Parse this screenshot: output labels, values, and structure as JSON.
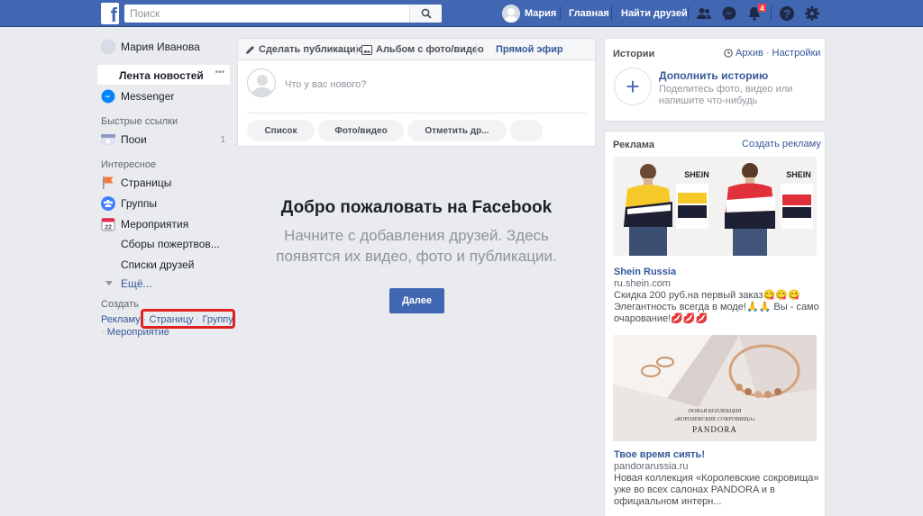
{
  "header": {
    "search_placeholder": "Поиск",
    "user_name": "Мария",
    "home": "Главная",
    "find_friends": "Найти друзей",
    "notifications_count": "4"
  },
  "sidebar": {
    "profile_name": "Мария Иванова",
    "feed": "Лента новостей",
    "feed_more": "•••",
    "messenger": "Messenger",
    "quick_links_title": "Быстрые ссылки",
    "quick_link": "Пooи",
    "quick_link_count": "1",
    "interesting_title": "Интересное",
    "pages": "Страницы",
    "groups": "Группы",
    "events": "Мероприятия",
    "fundraisers": "Сборы пожертвов...",
    "friend_lists": "Списки друзей",
    "more": "Ещё...",
    "create_title": "Создать",
    "create_ad": "Рекламу",
    "create_page": "Страницу",
    "create_group": "Группу",
    "create_event": "Мероприятие",
    "dot": "·"
  },
  "composer": {
    "tab_post": "Сделать публикацию",
    "tab_album": "Альбом с фото/видео",
    "tab_live": "Прямой эфир",
    "placeholder": "Что у вас нового?",
    "btn_list": "Список",
    "btn_photo": "Фото/видео",
    "btn_tag": "Отметить др..."
  },
  "welcome": {
    "title": "Добро пожаловать на Facebook",
    "subtitle_line1": "Начните с добавления друзей. Здесь",
    "subtitle_line2": "появятся их видео, фото и публикации.",
    "button": "Далее"
  },
  "stories": {
    "title": "Истории",
    "archive": "Архив",
    "settings": "Настройки",
    "add_title": "Дополнить историю",
    "add_desc_line1": "Поделитесь фото, видео или",
    "add_desc_line2": "напишите что-нибудь"
  },
  "ads": {
    "title": "Реклама",
    "create": "Создать рекламу",
    "shein_brand": "SHEIN",
    "shein_name": "Shein Russia",
    "shein_url": "ru.shein.com",
    "shein_line1": "Скидка 200 руб.на первый заказ😋😋😋",
    "shein_line2": "Элегантность всегда в моде!🙏🙏 Вы - само",
    "shein_line3": "очарование!💋💋💋",
    "pandora_caption1": "НОВАЯ КОЛЛЕКЦИЯ",
    "pandora_caption2": "«КОРОЛЕВСКИЕ СОКРОВИЩА»",
    "pandora_logo": "PANDORA",
    "pandora_name": "Твое время сиять!",
    "pandora_url": "pandorarussia.ru",
    "pandora_line1": "Новая коллекция «Королевские сокровища»",
    "pandora_line2": "уже во всех салонах PANDORA и в",
    "pandora_line3": "официальном интерн..."
  },
  "colors": {
    "brand_blue": "#4267b2",
    "link": "#365899",
    "highlight": "#e02020",
    "background": "#e9ebee"
  }
}
